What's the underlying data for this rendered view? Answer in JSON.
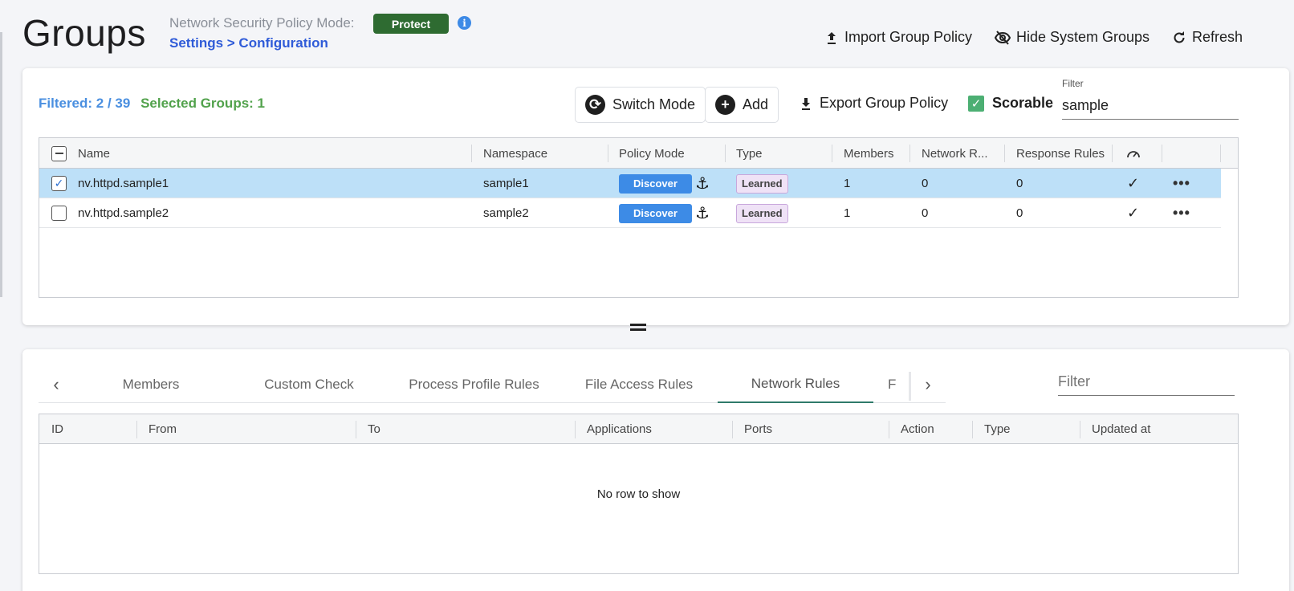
{
  "header": {
    "title": "Groups",
    "mode_label": "Network Security Policy Mode:",
    "mode_badge": "Protect",
    "breadcrumb": "Settings > Configuration",
    "actions": {
      "import": "Import Group Policy",
      "hide": "Hide System Groups",
      "refresh": "Refresh"
    }
  },
  "toolbar": {
    "filtered": "Filtered: 2 / 39",
    "selected": "Selected Groups:  1",
    "switch_mode": "Switch Mode",
    "add": "Add",
    "export": "Export Group Policy",
    "scorable": "Scorable",
    "filter_label": "Filter",
    "filter_value": "sample"
  },
  "groups_table": {
    "columns": [
      "Name",
      "Namespace",
      "Policy Mode",
      "Type",
      "Members",
      "Network R...",
      "Response Rules"
    ],
    "rows": [
      {
        "name": "nv.httpd.sample1",
        "namespace": "sample1",
        "policy_mode": "Discover",
        "type": "Learned",
        "members": "1",
        "network_rules": "0",
        "response_rules": "0",
        "scorable": "✓",
        "selected": true
      },
      {
        "name": "nv.httpd.sample2",
        "namespace": "sample2",
        "policy_mode": "Discover",
        "type": "Learned",
        "members": "1",
        "network_rules": "0",
        "response_rules": "0",
        "scorable": "✓",
        "selected": false
      }
    ]
  },
  "tabs": {
    "items": [
      "Members",
      "Custom Check",
      "Process Profile Rules",
      "File Access Rules",
      "Network Rules",
      "F"
    ],
    "active": "Network Rules",
    "filter_placeholder": "Filter"
  },
  "rules_table": {
    "columns": [
      "ID",
      "From",
      "To",
      "Applications",
      "Ports",
      "Action",
      "Type",
      "Updated at"
    ],
    "empty_text": "No row to show"
  },
  "colors": {
    "protect": "#2e6b31",
    "discover": "#3d8be6",
    "selected_row": "#bde0f8",
    "filtered_text": "#4a8fe0",
    "selected_text": "#52a24c"
  }
}
